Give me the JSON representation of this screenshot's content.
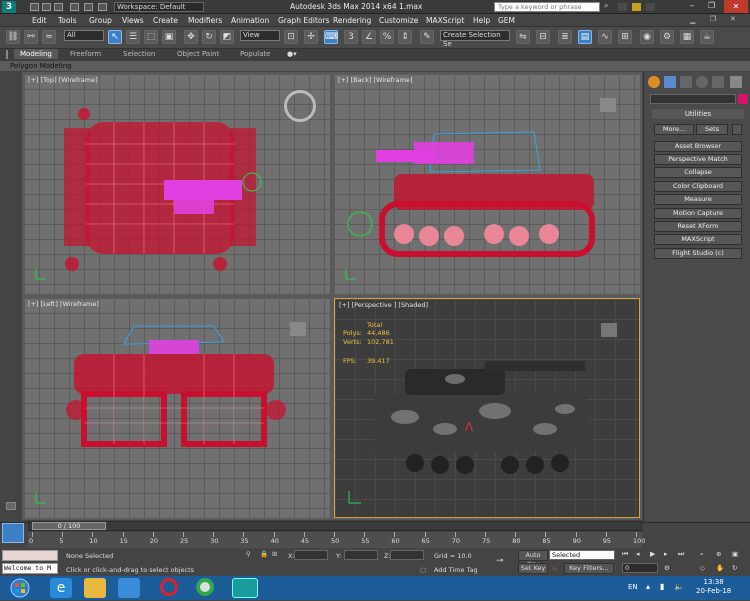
{
  "titlebar": {
    "workspace": "Workspace: Default",
    "app_title": "Autodesk 3ds Max  2014 x64     1.max",
    "search_placeholder": "Type a keyword or phrase"
  },
  "menu": [
    "Edit",
    "Tools",
    "Group",
    "Views",
    "Create",
    "Modifiers",
    "Animation",
    "Graph Editors",
    "Rendering",
    "Customize",
    "MAXScript",
    "Help",
    "GEM"
  ],
  "toolbar": {
    "filter_value": "All",
    "view_value": "View",
    "selection_set_placeholder": "Create Selection Se"
  },
  "ribbon": {
    "tabs": [
      "Modeling",
      "Freeform",
      "Selection",
      "Object Paint",
      "Populate"
    ],
    "active_tab": "Modeling",
    "subtitle": "Polygon Modeling"
  },
  "viewports": {
    "top_label": "[+] [Top] [Wireframe]",
    "back_label": "[+] [Back] [Wireframe]",
    "left_label": "[+] [Left] [Wireframe]",
    "persp_label": "[+] [Perspective ] [Shaded]",
    "stats": {
      "header": "Total",
      "polys_label": "Polys:",
      "polys": "44,486",
      "verts_label": "Verts:",
      "verts": "102,781",
      "fps_label": "FPS:",
      "fps": "39.417"
    }
  },
  "command_panel": {
    "utilities_title": "Utilities",
    "more_label": "More...",
    "sets_label": "Sets",
    "buttons": [
      "Asset Browser",
      "Perspective Match",
      "Collapse",
      "Color Clipboard",
      "Measure",
      "Motion Capture",
      "Reset XForm",
      "MAXScript",
      "Flight Studio (c)"
    ]
  },
  "timeline": {
    "frame_display": "0 / 100",
    "ticks": [
      "0",
      "5",
      "10",
      "15",
      "20",
      "25",
      "30",
      "35",
      "40",
      "45",
      "50",
      "55",
      "60",
      "65",
      "70",
      "75",
      "80",
      "85",
      "90",
      "95",
      "100"
    ]
  },
  "status": {
    "listener_text": "Welcome to M",
    "selection": "None Selected",
    "prompt": "Click or click-and-drag to select objects",
    "x_label": "X:",
    "y_label": "Y:",
    "z_label": "Z:",
    "grid": "Grid = 10.0",
    "add_time_tag": "Add Time Tag",
    "auto_key": "Auto Key",
    "set_key": "Set Key",
    "selected_value": "Selected",
    "key_filters": "Key Filters...",
    "current_frame": "0"
  },
  "taskbar": {
    "lang": "EN",
    "time": "13:38",
    "date": "20-Feb-18"
  },
  "colors": {
    "wire_red": "#c8102e",
    "wire_magenta": "#e040e0",
    "accent_blue": "#3c7fc4",
    "persp_border": "#d4a53a",
    "taskbar": "#1c5d99"
  }
}
